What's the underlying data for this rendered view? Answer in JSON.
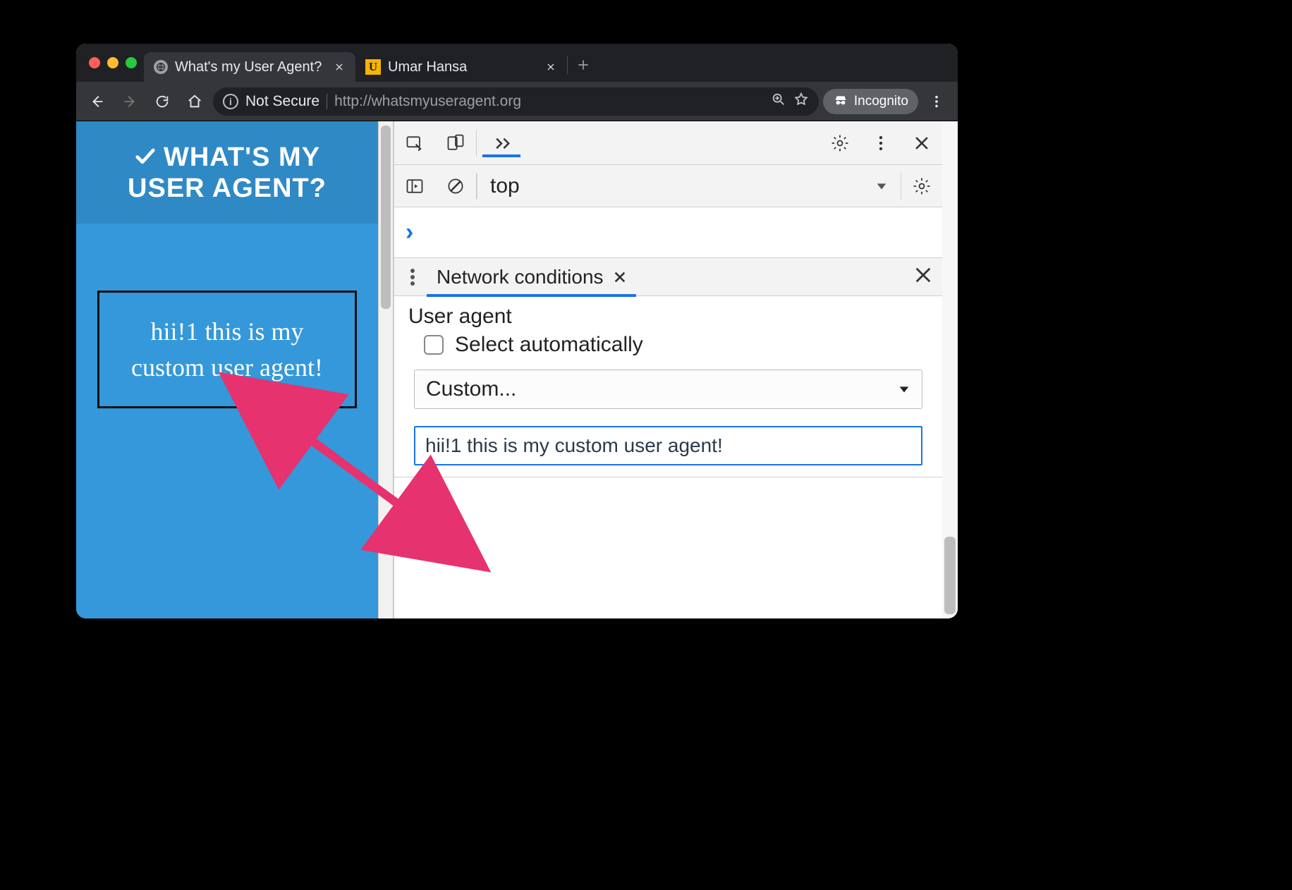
{
  "browser": {
    "tabs": [
      {
        "title": "What's my User Agent?",
        "favicon": "globe",
        "active": true
      },
      {
        "title": "Umar Hansa",
        "favicon": "U",
        "active": false
      }
    ],
    "security_label": "Not Secure",
    "url": "http://whatsmyuseragent.org",
    "incognito_label": "Incognito"
  },
  "page": {
    "heading_line1": "WHAT'S MY",
    "heading_line2": "USER AGENT?",
    "detected_ua": "hii!1 this is my custom user agent!"
  },
  "devtools": {
    "context": "top",
    "drawer_tab": "Network conditions",
    "section_title": "User agent",
    "checkbox_label": "Select automatically",
    "select_value": "Custom...",
    "ua_input_value": "hii!1 this is my custom user agent!"
  }
}
